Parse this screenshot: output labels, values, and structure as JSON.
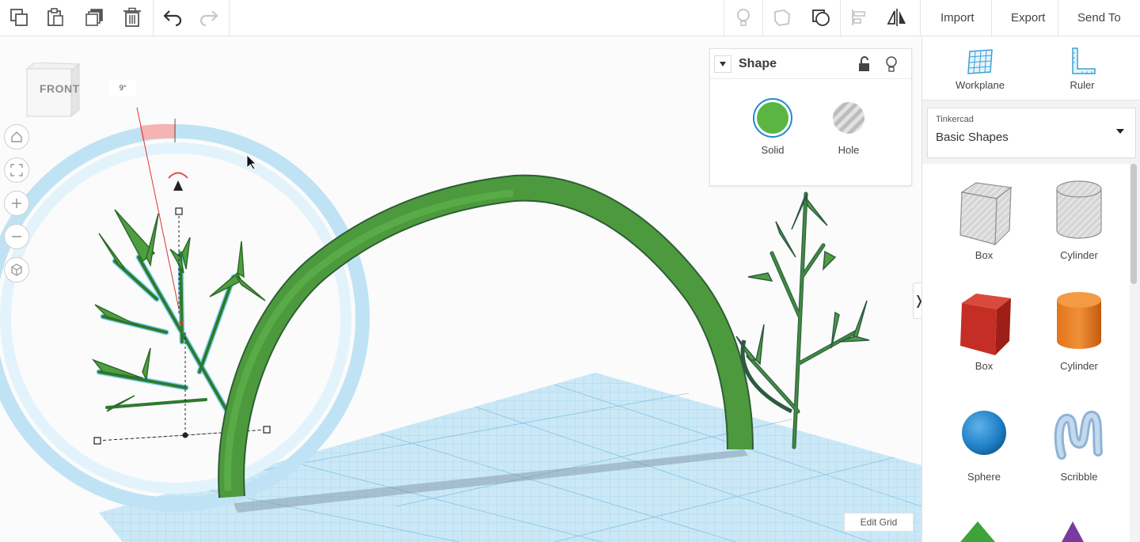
{
  "toolbar": {
    "import_label": "Import",
    "export_label": "Export",
    "send_to_label": "Send To"
  },
  "viewport": {
    "viewcube_label": "FRONT",
    "rotation_angle": "9°",
    "edit_grid_label": "Edit Grid"
  },
  "inspector": {
    "title": "Shape",
    "solid_label": "Solid",
    "hole_label": "Hole",
    "solid_color": "#5ab543",
    "accent": "#1f8bd0"
  },
  "panel": {
    "workplane_label": "Workplane",
    "ruler_label": "Ruler",
    "library_category": "Tinkercad",
    "library_name": "Basic Shapes",
    "shapes": [
      {
        "label": "Box"
      },
      {
        "label": "Cylinder"
      },
      {
        "label": "Box"
      },
      {
        "label": "Cylinder"
      },
      {
        "label": "Sphere"
      },
      {
        "label": "Scribble"
      }
    ]
  },
  "icons": [
    "copy-icon",
    "paste-icon",
    "duplicate-icon",
    "trash-icon",
    "undo-icon",
    "redo-icon",
    "bulb-icon",
    "note-icon",
    "group-icon",
    "align-icon",
    "mirror-icon",
    "home-icon",
    "fit-icon",
    "zoom-in-icon",
    "zoom-out-icon",
    "ortho-icon",
    "lock-icon",
    "workplane-icon",
    "ruler-icon"
  ]
}
